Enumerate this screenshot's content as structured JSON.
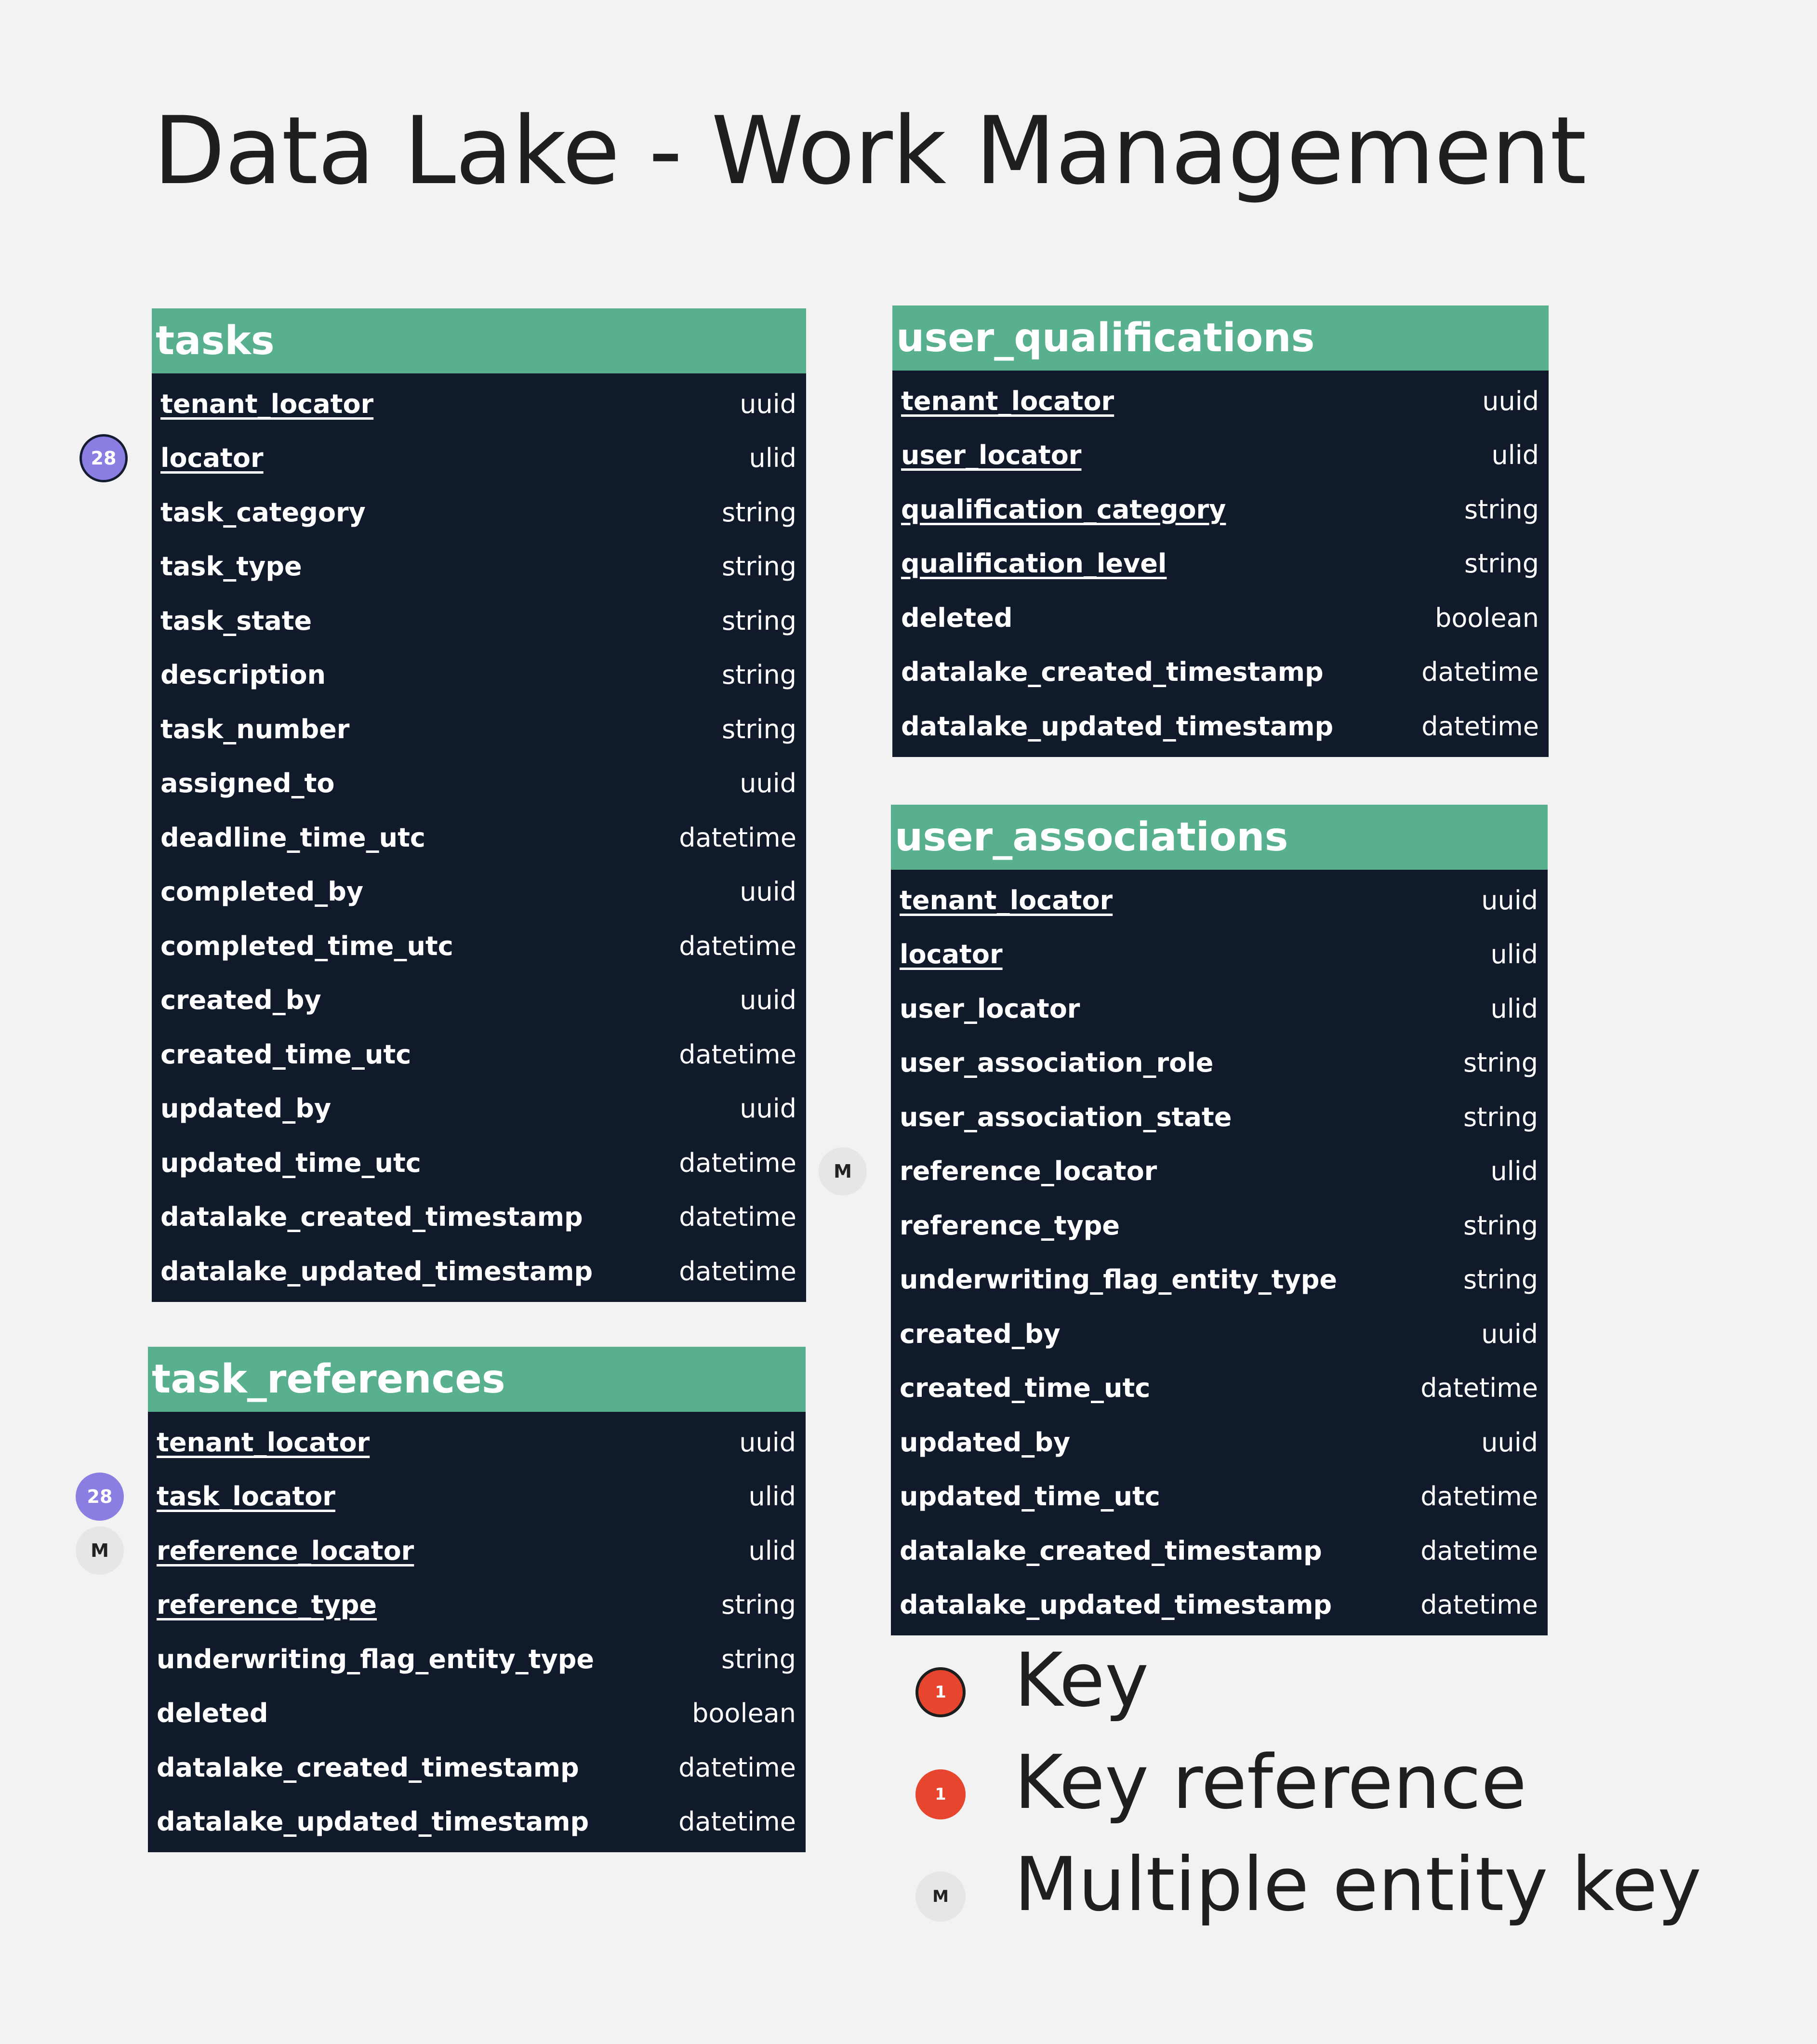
{
  "title": "Data Lake - Work Management",
  "entities": {
    "tasks": {
      "name": "tasks",
      "fields": [
        {
          "name": "tenant_locator",
          "type": "uuid",
          "key": true
        },
        {
          "name": "locator",
          "type": "ulid",
          "key": true,
          "badge": "28"
        },
        {
          "name": "task_category",
          "type": "string"
        },
        {
          "name": "task_type",
          "type": "string"
        },
        {
          "name": "task_state",
          "type": "string"
        },
        {
          "name": "description",
          "type": "string"
        },
        {
          "name": "task_number",
          "type": "string"
        },
        {
          "name": "assigned_to",
          "type": "uuid"
        },
        {
          "name": "deadline_time_utc",
          "type": "datetime"
        },
        {
          "name": "completed_by",
          "type": "uuid"
        },
        {
          "name": "completed_time_utc",
          "type": "datetime"
        },
        {
          "name": "created_by",
          "type": "uuid"
        },
        {
          "name": "created_time_utc",
          "type": "datetime"
        },
        {
          "name": "updated_by",
          "type": "uuid"
        },
        {
          "name": "updated_time_utc",
          "type": "datetime"
        },
        {
          "name": "datalake_created_timestamp",
          "type": "datetime"
        },
        {
          "name": "datalake_updated_timestamp",
          "type": "datetime"
        }
      ]
    },
    "task_references": {
      "name": "task_references",
      "fields": [
        {
          "name": "tenant_locator",
          "type": "uuid",
          "key": true
        },
        {
          "name": "task_locator",
          "type": "ulid",
          "key": true,
          "badge": "28"
        },
        {
          "name": "reference_locator",
          "type": "ulid",
          "key": true,
          "badge": "M"
        },
        {
          "name": "reference_type",
          "type": "string",
          "key": true
        },
        {
          "name": "underwriting_flag_entity_type",
          "type": "string"
        },
        {
          "name": "deleted",
          "type": "boolean"
        },
        {
          "name": "datalake_created_timestamp",
          "type": "datetime"
        },
        {
          "name": "datalake_updated_timestamp",
          "type": "datetime"
        }
      ]
    },
    "user_qualifications": {
      "name": "user_qualifications",
      "fields": [
        {
          "name": "tenant_locator",
          "type": "uuid",
          "key": true
        },
        {
          "name": "user_locator",
          "type": "ulid",
          "key": true
        },
        {
          "name": "qualification_category",
          "type": "string",
          "key": true
        },
        {
          "name": "qualification_level",
          "type": "string",
          "key": true
        },
        {
          "name": "deleted",
          "type": "boolean"
        },
        {
          "name": "datalake_created_timestamp",
          "type": "datetime"
        },
        {
          "name": "datalake_updated_timestamp",
          "type": "datetime"
        }
      ]
    },
    "user_associations": {
      "name": "user_associations",
      "fields": [
        {
          "name": "tenant_locator",
          "type": "uuid",
          "key": true
        },
        {
          "name": "locator",
          "type": "ulid",
          "key": true
        },
        {
          "name": "user_locator",
          "type": "ulid"
        },
        {
          "name": "user_association_role",
          "type": "string"
        },
        {
          "name": "user_association_state",
          "type": "string"
        },
        {
          "name": "reference_locator",
          "type": "ulid",
          "badge": "M"
        },
        {
          "name": "reference_type",
          "type": "string"
        },
        {
          "name": "underwriting_flag_entity_type",
          "type": "string"
        },
        {
          "name": "created_by",
          "type": "uuid"
        },
        {
          "name": "created_time_utc",
          "type": "datetime"
        },
        {
          "name": "updated_by",
          "type": "uuid"
        },
        {
          "name": "updated_time_utc",
          "type": "datetime"
        },
        {
          "name": "datalake_created_timestamp",
          "type": "datetime"
        },
        {
          "name": "datalake_updated_timestamp",
          "type": "datetime"
        }
      ]
    }
  },
  "legend": [
    {
      "icon": "key-icon",
      "symbol": "1",
      "label": "Key"
    },
    {
      "icon": "key-reference-icon",
      "symbol": "1",
      "label": "Key reference"
    },
    {
      "icon": "multiple-entity-key-icon",
      "symbol": "M",
      "label": "Multiple entity key"
    }
  ],
  "colors": {
    "header": "#59b08f",
    "body": "#111a2a",
    "background": "#f2f2f2",
    "key_count_badge": "#8b7ee3",
    "key_marker": "#e8452e",
    "multi_badge": "#e6e6e6"
  }
}
